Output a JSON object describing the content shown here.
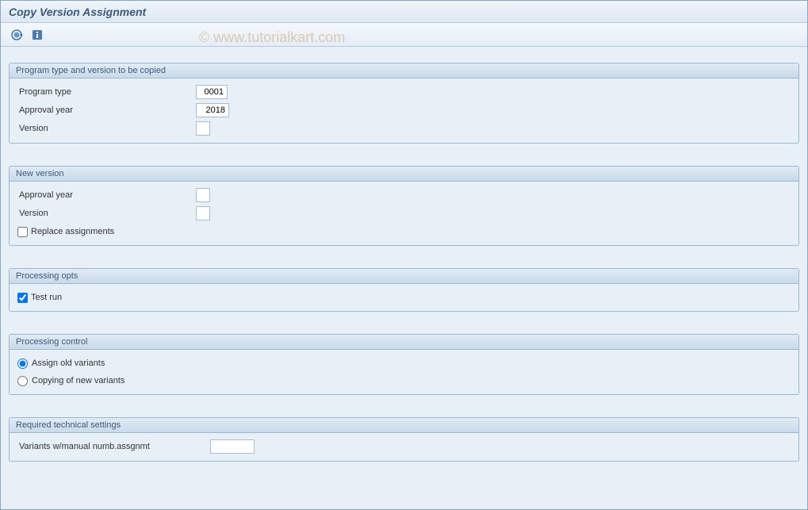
{
  "title": "Copy Version Assignment",
  "watermark": "© www.tutorialkart.com",
  "group1": {
    "title": "Program type and version to be copied",
    "program_type_label": "Program type",
    "program_type_value": "0001",
    "approval_year_label": "Approval year",
    "approval_year_value": "2018",
    "version_label": "Version",
    "version_value": ""
  },
  "group2": {
    "title": "New version",
    "approval_year_label": "Approval year",
    "approval_year_value": "",
    "version_label": "Version",
    "version_value": "",
    "replace_label": "Replace assignments",
    "replace_checked": false
  },
  "group3": {
    "title": "Processing opts",
    "testrun_label": "Test run",
    "testrun_checked": true
  },
  "group4": {
    "title": "Processing control",
    "radio1_label": "Assign old variants",
    "radio2_label": "Copying of new variants",
    "selected": "old"
  },
  "group5": {
    "title": "Required technical settings",
    "variants_label": "Variants w/manual numb.assgnmt",
    "variants_value": ""
  }
}
